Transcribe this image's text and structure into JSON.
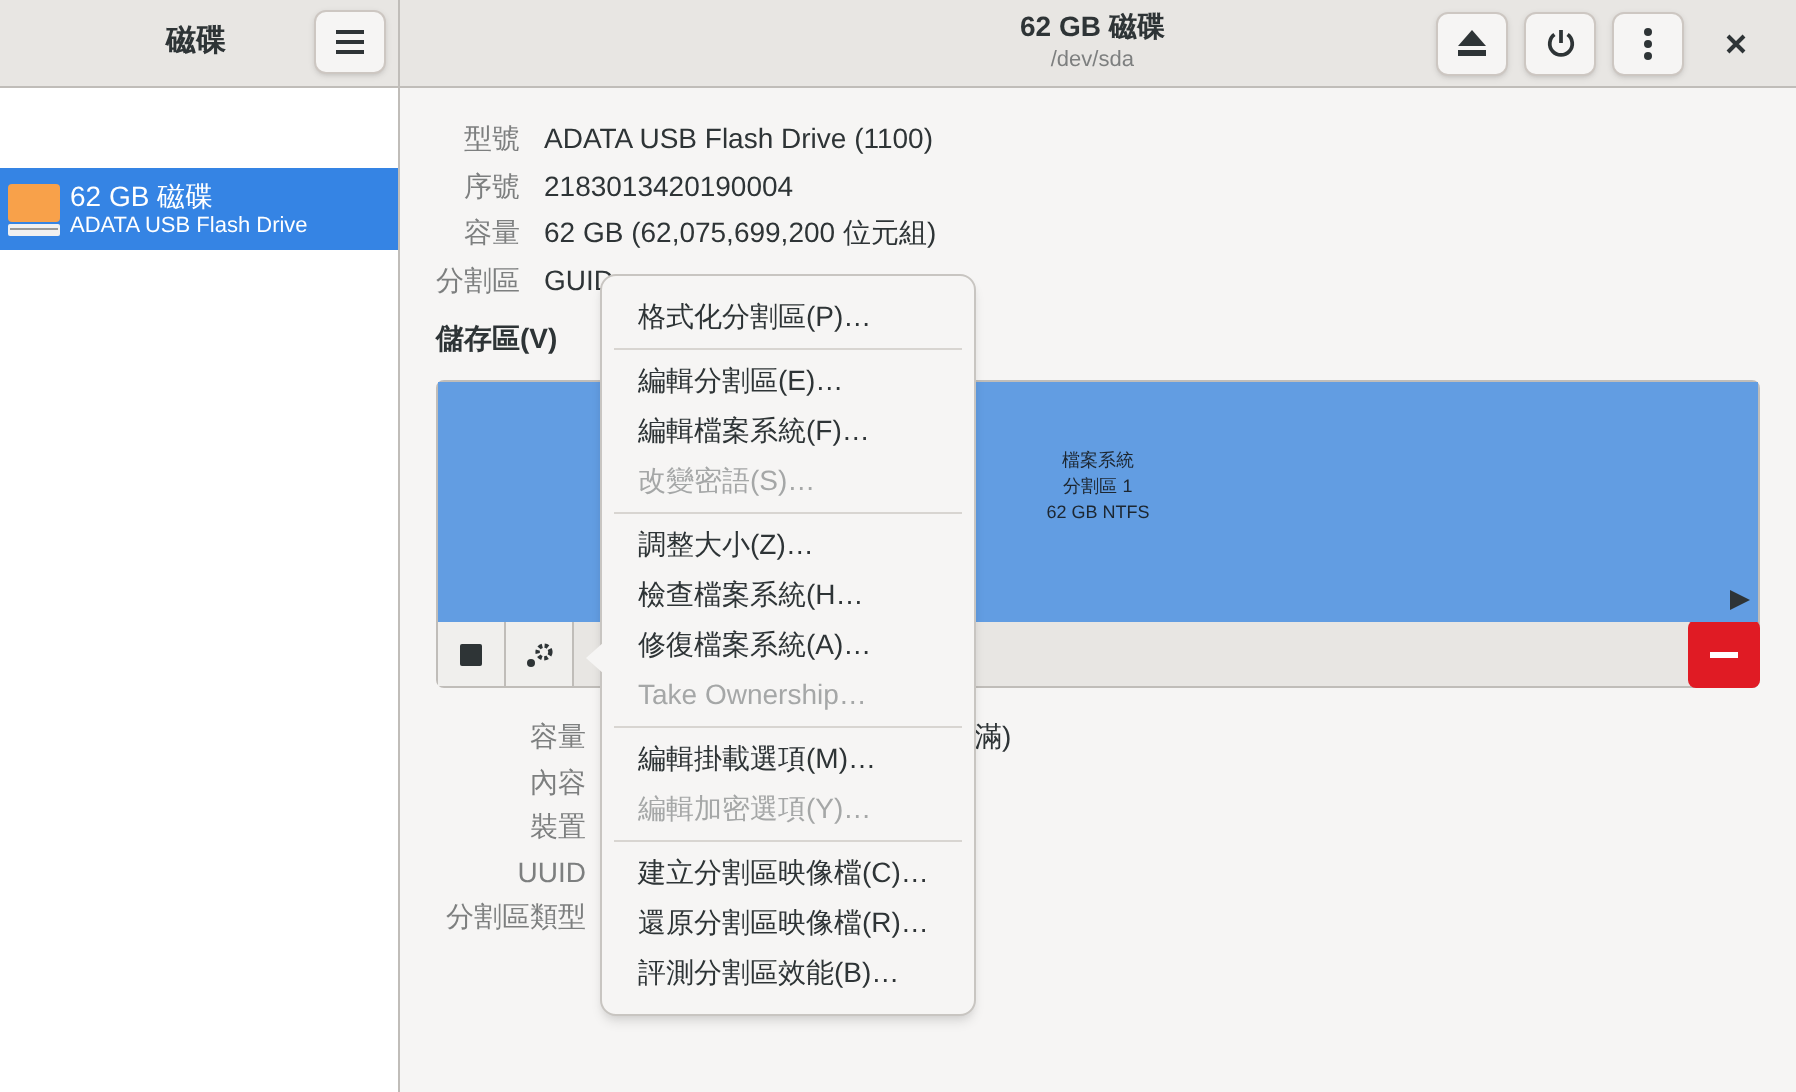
{
  "sidebar": {
    "title": "磁碟",
    "devices": [
      {
        "name": "62 GB 磁碟",
        "model": "ADATA USB Flash Drive",
        "selected": true
      }
    ]
  },
  "header": {
    "title": "62 GB 磁碟",
    "subtitle": "/dev/sda"
  },
  "drive_info": [
    {
      "label": "型號",
      "value": "ADATA USB Flash Drive (1100)"
    },
    {
      "label": "序號",
      "value": "2183013420190004"
    },
    {
      "label": "容量",
      "value": "62 GB (62,075,699,200 位元組)"
    },
    {
      "label": "分割區",
      "value": "GUID"
    }
  ],
  "volumes": {
    "title": "儲存區(V)",
    "partition": {
      "lines": [
        "檔案系統",
        "分割區 1",
        "62 GB NTFS"
      ],
      "selected": true
    }
  },
  "volume_info": [
    {
      "label": "容量",
      "value": "滿)"
    },
    {
      "label": "內容"
    },
    {
      "label": "裝置"
    },
    {
      "label": "UUID"
    },
    {
      "label": "分割區類型"
    }
  ],
  "menu": [
    [
      {
        "label": "格式化分割區(P)…",
        "disabled": false
      }
    ],
    [
      {
        "label": "編輯分割區(E)…",
        "disabled": false
      },
      {
        "label": "編輯檔案系統(F)…",
        "disabled": false
      },
      {
        "label": "改變密語(S)…",
        "disabled": true
      }
    ],
    [
      {
        "label": "調整大小(Z)…",
        "disabled": false
      },
      {
        "label": "檢查檔案系統(H…",
        "disabled": false
      },
      {
        "label": "修復檔案系統(A)…",
        "disabled": false
      },
      {
        "label": "Take Ownership…",
        "disabled": true
      }
    ],
    [
      {
        "label": "編輯掛載選項(M)…",
        "disabled": false
      },
      {
        "label": "編輯加密選項(Y)…",
        "disabled": true
      }
    ],
    [
      {
        "label": "建立分割區映像檔(C)…",
        "disabled": false
      },
      {
        "label": "還原分割區映像檔(R)…",
        "disabled": false
      },
      {
        "label": "評測分割區效能(B)…",
        "disabled": false
      }
    ]
  ]
}
